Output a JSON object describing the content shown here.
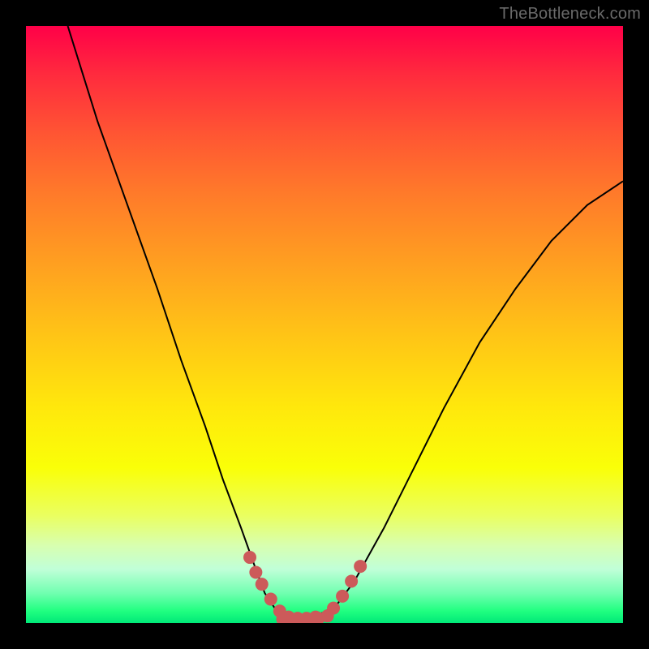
{
  "watermark": "TheBottleneck.com",
  "chart_data": {
    "type": "line",
    "title": "",
    "xlabel": "",
    "ylabel": "",
    "xlim": [
      0,
      100
    ],
    "ylim": [
      0,
      100
    ],
    "grid": false,
    "legend": false,
    "series": [
      {
        "name": "curve",
        "color": "#000000",
        "x": [
          7,
          12,
          17,
          22,
          26,
          30,
          33,
          36,
          38.5,
          40,
          42,
          44,
          46,
          48,
          52,
          55,
          60,
          65,
          70,
          76,
          82,
          88,
          94,
          100
        ],
        "y": [
          100,
          84,
          70,
          56,
          44,
          33,
          24,
          16,
          9,
          5,
          2,
          0.8,
          0.5,
          0.8,
          3,
          7,
          16,
          26,
          36,
          47,
          56,
          64,
          70,
          74
        ]
      }
    ],
    "overlays": [
      {
        "name": "marker-cluster-left",
        "type": "scatter",
        "color": "#cc5a5a",
        "x": [
          37.5,
          38.5,
          39.5,
          41,
          42.5,
          44,
          45.5,
          47,
          48.5
        ],
        "y": [
          11,
          8.5,
          6.5,
          4,
          2,
          1,
          0.8,
          0.8,
          1
        ]
      },
      {
        "name": "marker-cluster-bottom",
        "type": "scatter",
        "color": "#cc5a5a",
        "x": [
          43,
          44.5,
          46,
          47.5,
          49,
          50.5
        ],
        "y": [
          0.6,
          0.5,
          0.5,
          0.6,
          0.8,
          1.2
        ]
      },
      {
        "name": "marker-cluster-right",
        "type": "scatter",
        "color": "#cc5a5a",
        "x": [
          51.5,
          53,
          54.5,
          56
        ],
        "y": [
          2.5,
          4.5,
          7,
          9.5
        ]
      }
    ],
    "background_gradient": {
      "direction": "vertical",
      "stops": [
        {
          "pos": 0.0,
          "color": "#ff0048"
        },
        {
          "pos": 0.18,
          "color": "#ff5533"
        },
        {
          "pos": 0.4,
          "color": "#ffa020"
        },
        {
          "pos": 0.64,
          "color": "#ffe80c"
        },
        {
          "pos": 0.82,
          "color": "#eaff60"
        },
        {
          "pos": 0.95,
          "color": "#70ffb0"
        },
        {
          "pos": 1.0,
          "color": "#00e878"
        }
      ]
    }
  }
}
